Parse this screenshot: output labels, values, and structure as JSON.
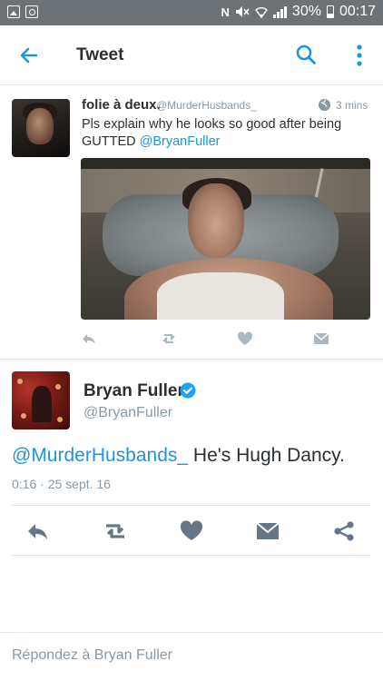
{
  "status_bar": {
    "battery": "30%",
    "time": "00:17",
    "nfc_glyph": "N",
    "icons": [
      "image-icon",
      "bag-icon",
      "nfc-icon",
      "mute-icon",
      "wifi-icon",
      "signal-icon",
      "battery-icon"
    ]
  },
  "app_bar": {
    "title": "Tweet",
    "icons": [
      "back-arrow-icon",
      "search-icon",
      "more-vertical-icon"
    ]
  },
  "original_tweet": {
    "display_name": "folie à deux.",
    "handle": "@MurderHusbands_",
    "time": "3 mins",
    "text_before": "Pls explain why he looks so good after being GUTTED ",
    "mention": "@BryanFuller",
    "actions": [
      "reply-icon",
      "retweet-icon",
      "like-icon",
      "message-icon"
    ]
  },
  "tweet": {
    "display_name": "Bryan Fuller",
    "handle": "@BryanFuller",
    "mention": "@MurderHusbands_",
    "text": " He's Hugh Dancy.",
    "timestamp": "0:16 · 25 sept. 16",
    "actions": [
      "reply-icon",
      "retweet-icon",
      "like-icon",
      "message-icon",
      "share-icon"
    ]
  },
  "reply": {
    "placeholder": "Répondez à Bryan Fuller"
  },
  "colors": {
    "accent": "#1b95e0",
    "icon_gray": "#8899a6",
    "verified": "#1da1f2",
    "status_bar": "#6d7276"
  }
}
